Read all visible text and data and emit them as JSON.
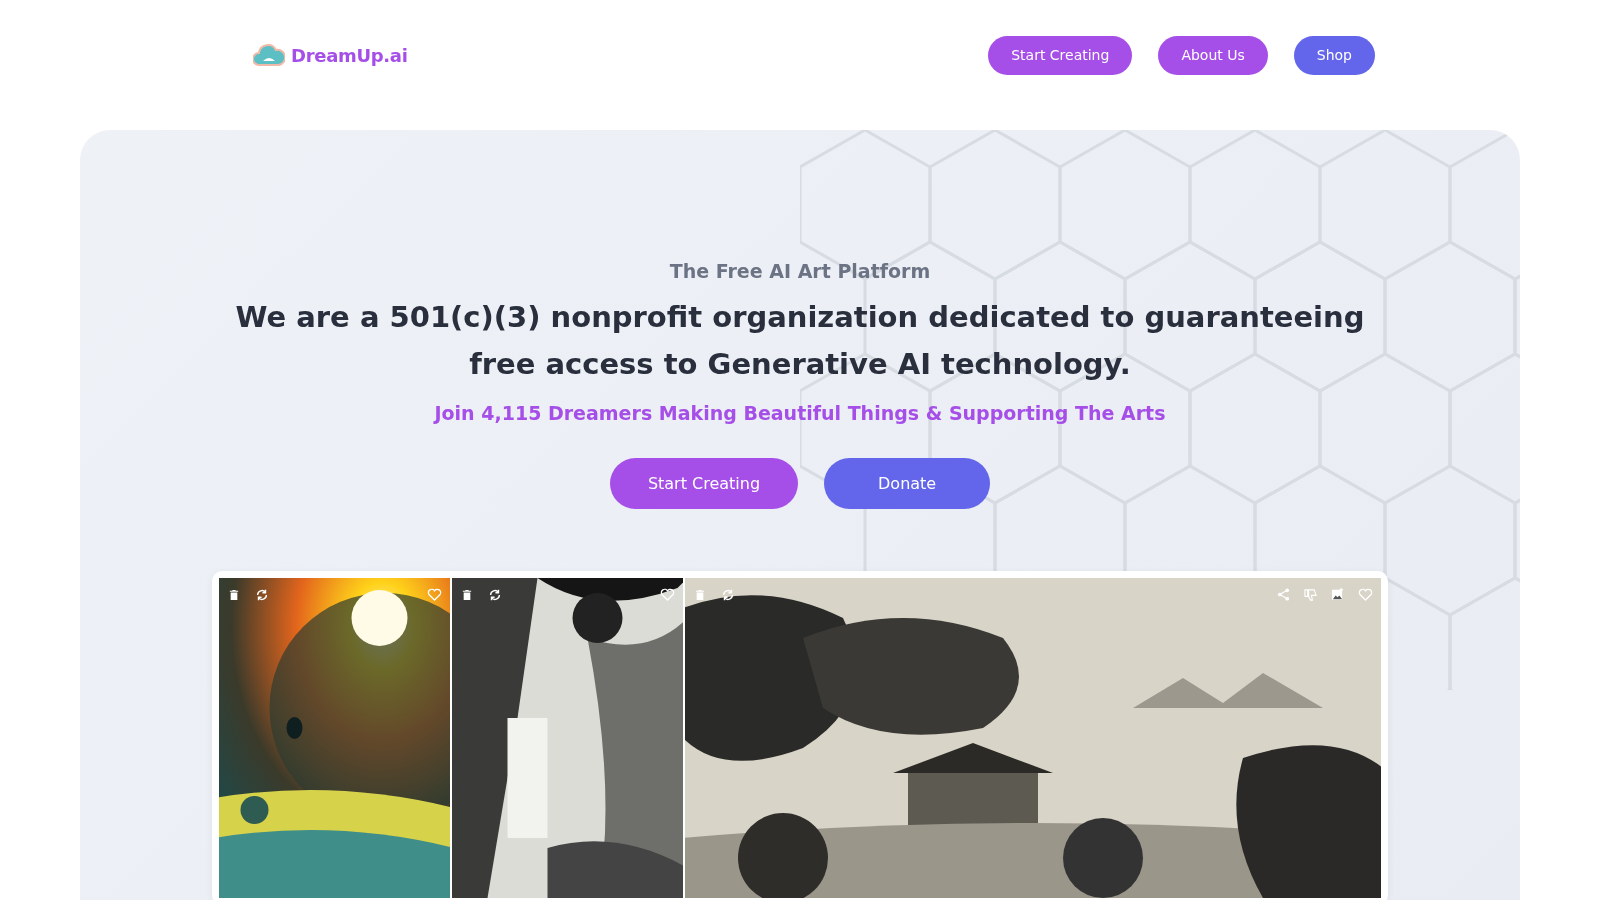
{
  "header": {
    "logo": "DreamUp.ai",
    "nav": [
      {
        "label": "Start Creating",
        "kind": "purple"
      },
      {
        "label": "About Us",
        "kind": "purple"
      },
      {
        "label": "Shop",
        "kind": "blue"
      }
    ]
  },
  "hero": {
    "eyebrow": "The Free AI Art Platform",
    "headline": "We are a 501(c)(3) nonprofit organization dedicated to guaranteeing free access to Generative AI technology.",
    "tagline": "Join 4,115 Dreamers Making Beautiful Things & Supporting The Arts",
    "buttons": [
      {
        "label": "Start Creating",
        "kind": "purple"
      },
      {
        "label": "Donate",
        "kind": "blue"
      }
    ]
  },
  "gallery": [
    {
      "kind": "tall"
    },
    {
      "kind": "tall"
    },
    {
      "kind": "wide"
    }
  ]
}
